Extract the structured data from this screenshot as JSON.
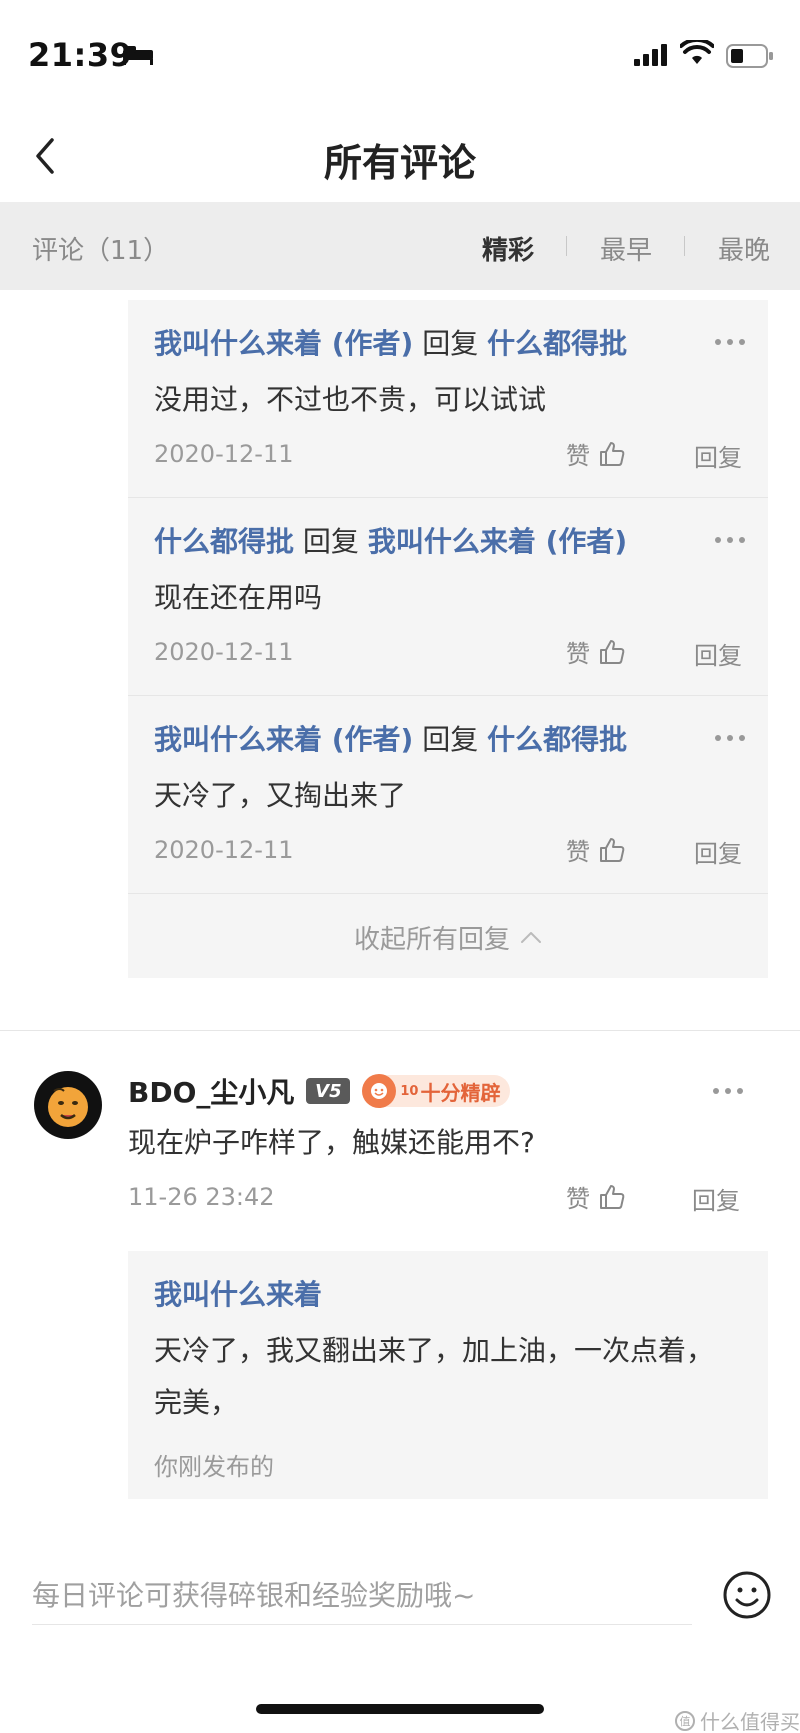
{
  "status_bar": {
    "time": "21:39"
  },
  "nav": {
    "title": "所有评论"
  },
  "tabs": {
    "count_label": "评论（11）",
    "items": [
      {
        "label": "精彩",
        "active": true
      },
      {
        "label": "最早",
        "active": false
      },
      {
        "label": "最晚",
        "active": false
      }
    ]
  },
  "replies": [
    {
      "from": "我叫什么来着 (作者)",
      "verb": "回复",
      "to": "什么都得批",
      "text": "没用过，不过也不贵，可以试试",
      "date": "2020-12-11",
      "like_label": "赞",
      "reply_label": "回复"
    },
    {
      "from": "什么都得批",
      "verb": "回复",
      "to": "我叫什么来着 (作者)",
      "text": "现在还在用吗",
      "date": "2020-12-11",
      "like_label": "赞",
      "reply_label": "回复"
    },
    {
      "from": "我叫什么来着 (作者)",
      "verb": "回复",
      "to": "什么都得批",
      "text": "天冷了，又掏出来了",
      "date": "2020-12-11",
      "like_label": "赞",
      "reply_label": "回复"
    }
  ],
  "collapse_label": "收起所有回复",
  "comment": {
    "username": "BDO_尘小凡",
    "level": "V5",
    "medal_number": "10",
    "medal_text": "十分精辟",
    "text": "现在炉子咋样了，触媒还能用不?",
    "date": "11-26 23:42",
    "like_label": "赞",
    "reply_label": "回复",
    "nested_reply": {
      "username": "我叫什么来着",
      "text": "天冷了，我又翻出来了，加上油，一次点着，完美，",
      "status": "你刚发布的"
    }
  },
  "input": {
    "placeholder": "每日评论可获得碎银和经验奖励哦~"
  },
  "watermark": "什么值得买",
  "colors": {
    "link_blue": "#4a6ea9",
    "background_gray": "#ededed",
    "card_gray": "#f5f5f5",
    "medal_orange": "#e3643a"
  }
}
